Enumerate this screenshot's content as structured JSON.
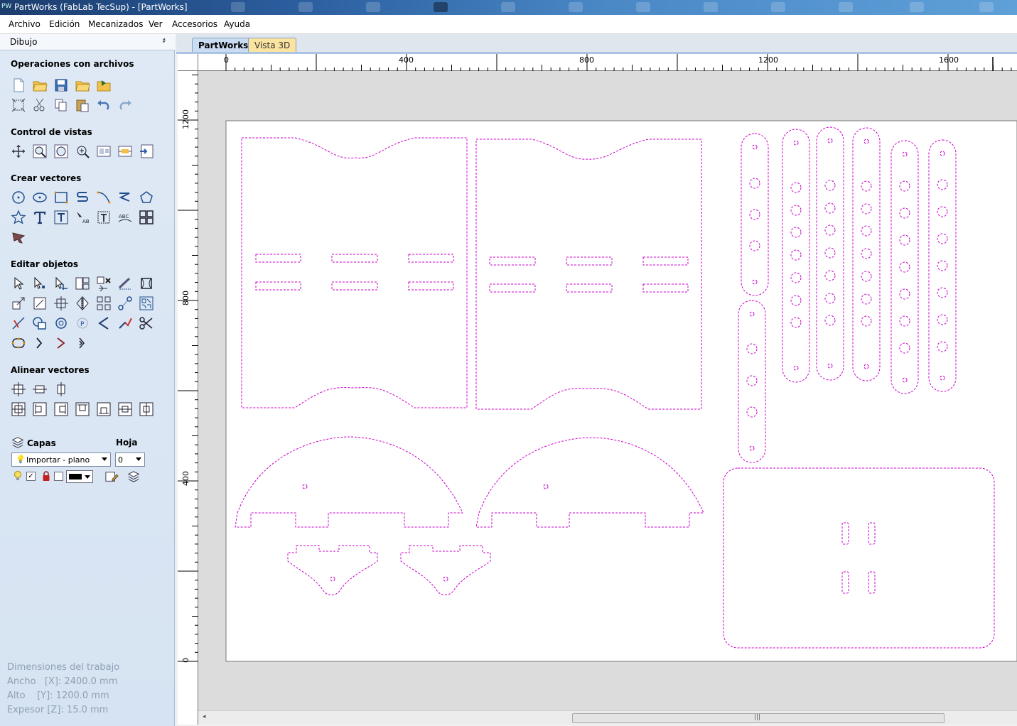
{
  "window": {
    "title": "PartWorks (FabLab TecSup) - [PartWorks]",
    "logo": "PW"
  },
  "menu": [
    "Archivo",
    "Edición",
    "Mecanizados",
    "Ver",
    "Accesorios",
    "Ayuda"
  ],
  "panel": {
    "header": "Dibujo",
    "pin": "♯",
    "sections": {
      "files": "Operaciones con archivos",
      "views": "Control de vistas",
      "create": "Crear vectores",
      "edit": "Editar objetos",
      "align": "Alinear vectores",
      "layers": "Capas",
      "sheet": "Hoja"
    },
    "layer_select": "Importar - plano",
    "sheet_select": "0",
    "dimensions": {
      "title": "Dimensiones del trabajo",
      "width": "Ancho   [X]: 2400.0 mm",
      "height": "Alto    [Y]: 1200.0 mm",
      "thickness": "Expesor [Z]: 15.0 mm"
    }
  },
  "tabs": [
    "PartWorks",
    "Vista 3D"
  ],
  "ruler": {
    "h_labels": [
      "0",
      "400",
      "800",
      "1200",
      "1600"
    ],
    "v_labels": [
      "1200",
      "800",
      "400",
      "0"
    ]
  },
  "scrollbar": {
    "grip": "|||",
    "left_arrow": "◂"
  },
  "colors": {
    "vector": "#cc00cc",
    "workarea": "#dcdcdc",
    "panel": "#d6e3f2"
  }
}
